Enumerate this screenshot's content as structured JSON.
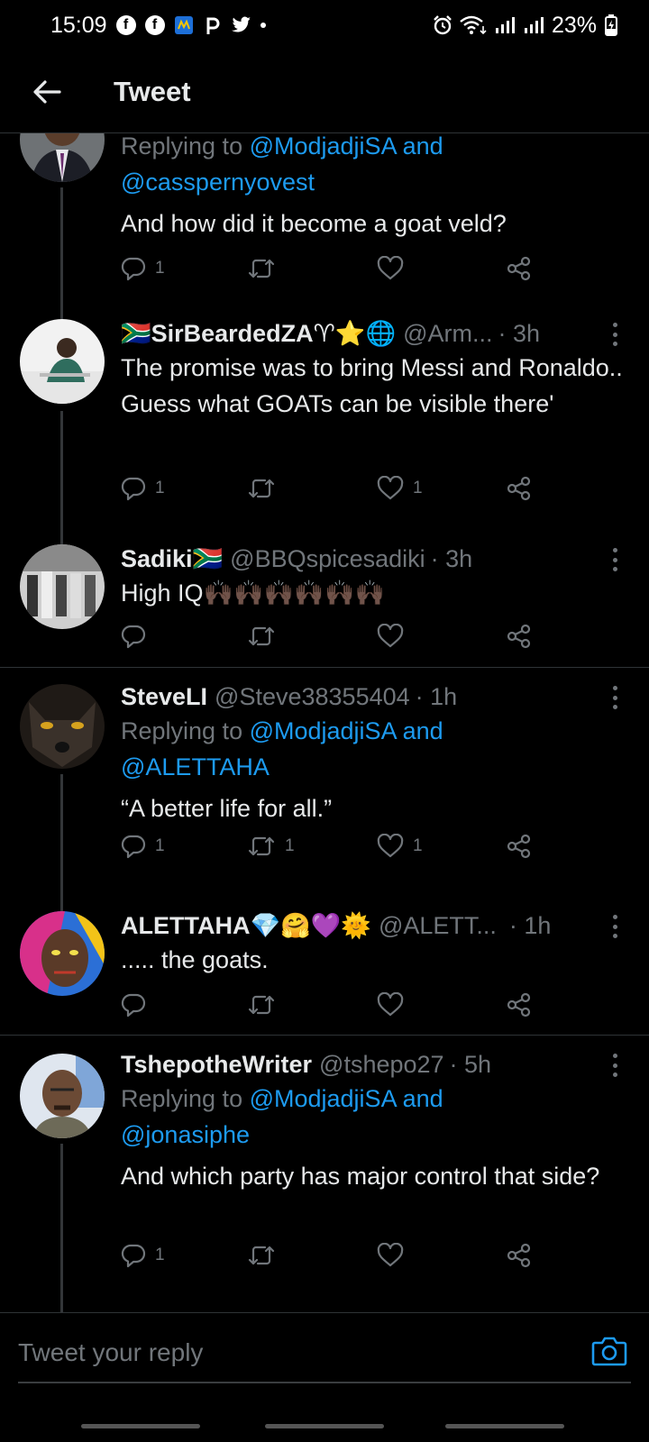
{
  "status_bar": {
    "time": "15:09",
    "battery": "23%"
  },
  "header": {
    "title": "Tweet"
  },
  "tweets": [
    {
      "replying_prefix": "Replying to ",
      "mention1": "@ModjadjiSA",
      "and": " and",
      "mention2": "@casspernyovest",
      "text": "And how did it become a goat veld?",
      "replies": "1",
      "retweets": "",
      "likes": ""
    },
    {
      "name": "🇿🇦SirBeardedZA♈⭐🌐",
      "handle": "@Arm...",
      "time": "· 3h",
      "text": "The promise was to bring Messi and Ronaldo.. Guess what GOATs can be visible there'",
      "replies": "1",
      "retweets": "",
      "likes": "1"
    },
    {
      "name": "Sadiki🇿🇦",
      "handle": "@BBQspicesadiki",
      "time": "· 3h",
      "text": "High IQ🙌🏿🙌🏿🙌🏿🙌🏿🙌🏿🙌🏿",
      "replies": "",
      "retweets": "",
      "likes": ""
    },
    {
      "name": "SteveLI",
      "handle": "@Steve38355404",
      "time": "· 1h",
      "replying_prefix": "Replying to ",
      "mention1": "@ModjadjiSA",
      "and": " and",
      "mention2": "@ALETTAHA",
      "text": "“A better life for all.”",
      "replies": "1",
      "retweets": "1",
      "likes": "1"
    },
    {
      "name": "ALETTAHA💎🤗💜🌞",
      "handle": "@ALETT...",
      "time": "· 1h",
      "text": "..... the goats.",
      "replies": "",
      "retweets": "",
      "likes": ""
    },
    {
      "name": "TshepotheWriter",
      "handle": "@tshepo27",
      "time": "· 5h",
      "replying_prefix": "Replying to ",
      "mention1": "@ModjadjiSA",
      "and": " and",
      "mention2": "@jonasiphe",
      "text": "And which party has major control that side?",
      "replies": "1",
      "retweets": "",
      "likes": ""
    }
  ],
  "reply_bar": {
    "placeholder": "Tweet your reply"
  },
  "colors": {
    "background": "#000000",
    "accent": "#1d9bf0",
    "muted": "#71767b",
    "divider": "#2f3336"
  },
  "icons": [
    "back-arrow-icon",
    "reply-icon",
    "retweet-icon",
    "like-icon",
    "share-icon",
    "more-icon",
    "camera-icon"
  ]
}
